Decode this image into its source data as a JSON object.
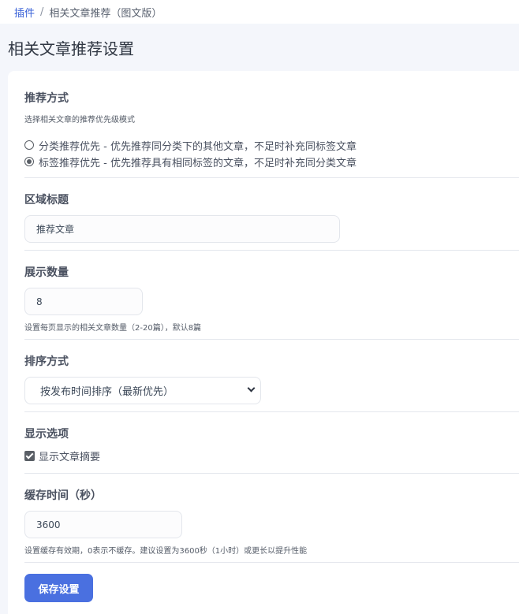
{
  "breadcrumb": {
    "root": "插件",
    "separator": "/",
    "current": "相关文章推荐（图文版）"
  },
  "page_title": "相关文章推荐设置",
  "recommend_mode": {
    "title": "推荐方式",
    "description": "选择相关文章的推荐优先级模式",
    "options": [
      {
        "label": "分类推荐优先 - 优先推荐同分类下的其他文章，不足时补充同标签文章",
        "checked": false
      },
      {
        "label": "标签推荐优先 - 优先推荐具有相同标签的文章，不足时补充同分类文章",
        "checked": true
      }
    ]
  },
  "section_title": {
    "title": "区域标题",
    "value": "推荐文章"
  },
  "display_count": {
    "title": "展示数量",
    "value": "8",
    "hint": "设置每页显示的相关文章数量（2-20篇），默认8篇"
  },
  "sort_mode": {
    "title": "排序方式",
    "selected": "按发布时间排序（最新优先）"
  },
  "display_options": {
    "title": "显示选项",
    "show_excerpt_label": "显示文章摘要",
    "show_excerpt_checked": true
  },
  "cache_time": {
    "title": "缓存时间（秒）",
    "value": "3600",
    "hint": "设置缓存有效期，0表示不缓存。建议设置为3600秒（1小时）或更长以提升性能"
  },
  "save_button": "保存设置",
  "colors": {
    "accent": "#4a70e0",
    "link": "#3b63d8",
    "page_bg": "#f4f6fb"
  }
}
